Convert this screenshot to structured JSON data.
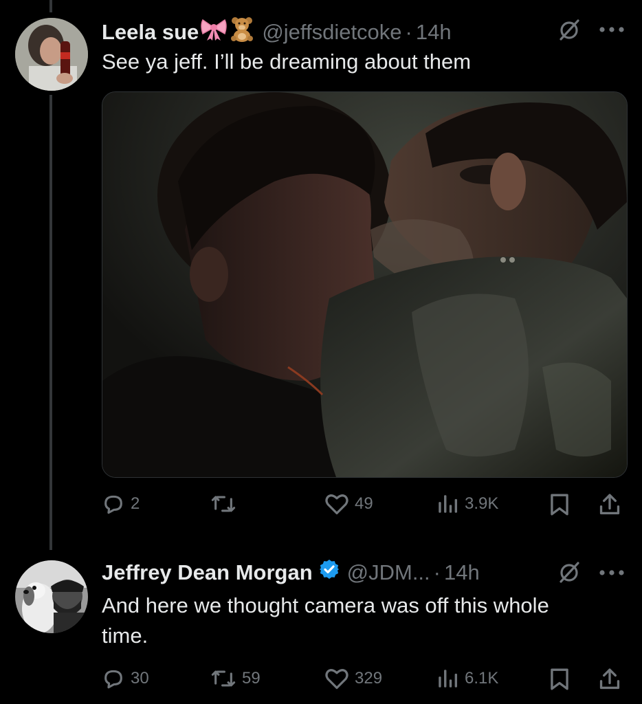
{
  "tweet1": {
    "display_name": "Leela sue",
    "emojis": [
      "bow-emoji",
      "teddy-bear-emoji"
    ],
    "handle": "@jeffsdietcoke",
    "separator": "·",
    "time": "14h",
    "text": "See ya jeff. I’ll be dreaming about them",
    "media_icon": "image",
    "stats": {
      "replies": "2",
      "retweets": "",
      "likes": "49",
      "views": "3.9K"
    }
  },
  "tweet2": {
    "display_name": "Jeffrey Dean Morgan",
    "verified": true,
    "handle": "@JDM...",
    "separator": "·",
    "time": "14h",
    "text": "And here we thought camera was off this whole time.",
    "stats": {
      "replies": "30",
      "retweets": "59",
      "likes": "329",
      "views": "6.1K"
    }
  },
  "colors": {
    "background": "#000000",
    "text": "#e7e9ea",
    "muted": "#71767b",
    "verified": "#1d9bf0",
    "thread_line": "#333639"
  },
  "icons": [
    "grok-icon",
    "more-icon",
    "reply-icon",
    "retweet-icon",
    "like-icon",
    "views-icon",
    "bookmark-icon",
    "share-icon",
    "verified-badge-icon"
  ]
}
